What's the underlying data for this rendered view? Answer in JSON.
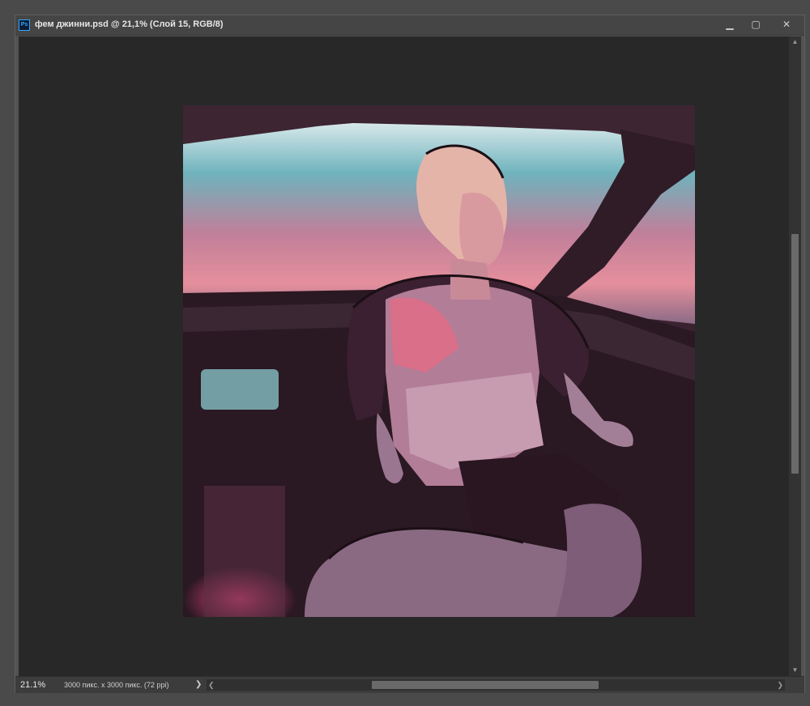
{
  "window": {
    "title": "фем джинни.psd @ 21,1% (Слой 15, RGB/8)",
    "app_icon_label": "Ps",
    "controls": {
      "minimize": "▁",
      "maximize": "▢",
      "close": "✕"
    }
  },
  "status": {
    "zoom": "21.1%",
    "doc_info": "3000 пикс. x 3000 пикс. (72 ppi)",
    "more_arrow": "❯"
  },
  "scroll": {
    "up": "▲",
    "down": "▼",
    "left": "❮",
    "right": "❯"
  },
  "colors": {
    "canvas_bg": "#282828",
    "panel": "#535353",
    "accent": "#31a8ff"
  },
  "icons": {
    "app": "photoshop-icon",
    "minimize": "minimize-icon",
    "maximize": "maximize-icon",
    "close": "close-icon"
  }
}
